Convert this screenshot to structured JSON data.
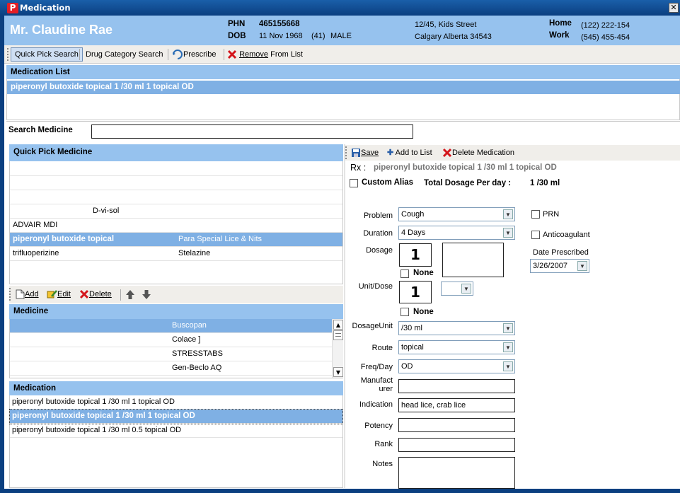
{
  "window": {
    "title": "Medication",
    "close_glyph": "✕",
    "logo_letter": "P"
  },
  "patient": {
    "name": "Mr. Claudine  Rae",
    "phn_label": "PHN",
    "phn": "465155668",
    "dob_label": "DOB",
    "dob": "11 Nov 1968",
    "age": "(41)",
    "sex": "MALE",
    "address1": "12/45, Kids Street",
    "address2": "Calgary Alberta 34543",
    "home_label": "Home",
    "home": "(122) 222-154",
    "work_label": "Work",
    "work": "(545) 455-454"
  },
  "toolbar": {
    "quick_pick": "Quick Pick Search",
    "drug_category": "Drug Category Search",
    "prescribe": "Prescribe",
    "remove": "Remove",
    "remove_suffix": "From List"
  },
  "medication_list": {
    "header": "Medication List",
    "items": [
      "piperonyl butoxide topical 1 /30 ml 1 topical OD"
    ]
  },
  "search": {
    "label": "Search Medicine",
    "value": ""
  },
  "quick_pick": {
    "header": "Quick Pick Medicine",
    "rows": [
      {
        "name": "",
        "brand": ""
      },
      {
        "name": "",
        "brand": ""
      },
      {
        "name": "",
        "brand": ""
      },
      {
        "name": "",
        "brand": "D-vi-sol"
      },
      {
        "name": "ADVAIR MDI",
        "brand": ""
      },
      {
        "name": "piperonyl butoxide topical",
        "brand": "Para Special Lice & Nits"
      },
      {
        "name": "trifluoperizine",
        "brand": "Stelazine"
      }
    ]
  },
  "list_toolbar": {
    "add": "Add",
    "edit": "Edit",
    "delete": "Delete"
  },
  "medicine": {
    "header": "Medicine",
    "rows": [
      "Buscopan",
      "Colace ]",
      "STRESSTABS",
      "Gen-Beclo AQ"
    ]
  },
  "medication": {
    "header": "Medication",
    "rows": [
      "piperonyl butoxide topical 1 /30 ml 1 topical OD",
      "piperonyl butoxide topical 1 /30 ml 1 topical OD",
      "piperonyl butoxide topical 1 /30 ml 0.5 topical OD"
    ]
  },
  "form_toolbar": {
    "save": "Save",
    "add_to_list": "Add to List",
    "delete_medication": "Delete Medication"
  },
  "rx": {
    "label": "Rx :",
    "value": "piperonyl butoxide topical 1 /30 ml 1 topical OD"
  },
  "custom_alias": {
    "label": "Custom Alias"
  },
  "total_dosage": {
    "label": "Total Dosage Per day :",
    "value": "1 /30 ml"
  },
  "form": {
    "problem_label": "Problem",
    "problem": "Cough",
    "duration_label": "Duration",
    "duration": "4 Days",
    "dosage_label": "Dosage",
    "dosage": "1",
    "none_label": "None",
    "unit_dose_label": "Unit/Dose",
    "unit_dose": "1",
    "dosage_unit_label": "DosageUnit",
    "dosage_unit": "/30 ml",
    "route_label": "Route",
    "route": "topical",
    "freq_label": "Freq/Day",
    "freq": "OD",
    "manufacturer_label": "Manufact urer",
    "manufacturer": "",
    "indication_label": "Indication",
    "indication": "head lice, crab lice",
    "potency_label": "Potency",
    "potency": "",
    "rank_label": "Rank",
    "rank": "",
    "notes_label": "Notes",
    "notes": ""
  },
  "side": {
    "prn_label": "PRN",
    "anticoagulant_label": "Anticoagulant",
    "date_prescribed_label": "Date Prescribed",
    "date_prescribed": "3/26/2007"
  },
  "colors": {
    "titlebar": "#0b3f80",
    "header_blue": "#96c2ee",
    "selection": "#7fb0e4",
    "delete_red": "#d4161c"
  }
}
